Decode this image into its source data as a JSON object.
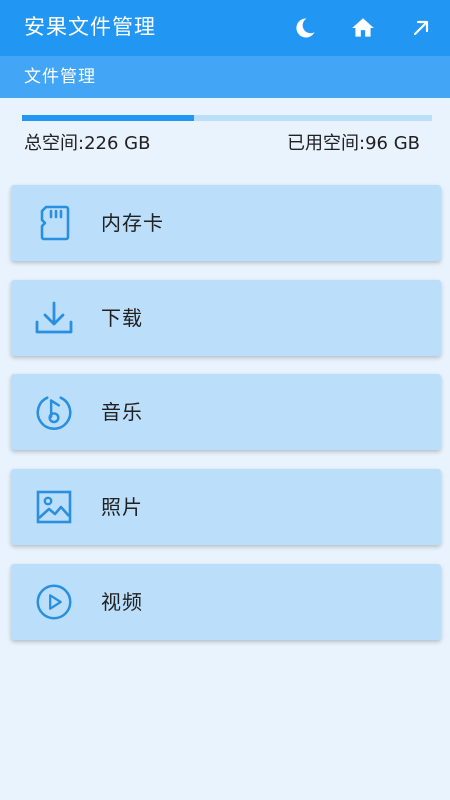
{
  "app_bar": {
    "title": "安果文件管理",
    "actions": [
      {
        "icon": "moon-icon"
      },
      {
        "icon": "home-icon"
      },
      {
        "icon": "arrow-up-right-icon"
      }
    ]
  },
  "sub_header": {
    "title": "文件管理"
  },
  "storage": {
    "total_label": "总空间: ",
    "total_value": "226 GB",
    "used_label": "已用空间: ",
    "used_value": "96 GB",
    "used_fraction": 0.42
  },
  "menu": [
    {
      "label": "内存卡",
      "icon": "sd-card-icon"
    },
    {
      "label": "下载",
      "icon": "download-icon"
    },
    {
      "label": "音乐",
      "icon": "music-note-icon"
    },
    {
      "label": "照片",
      "icon": "image-icon"
    },
    {
      "label": "视频",
      "icon": "play-circle-icon"
    }
  ],
  "colors": {
    "primary": "#2196f3",
    "secondary": "#42a5f5",
    "card": "#bbdefb",
    "background": "#e8f3fd"
  }
}
